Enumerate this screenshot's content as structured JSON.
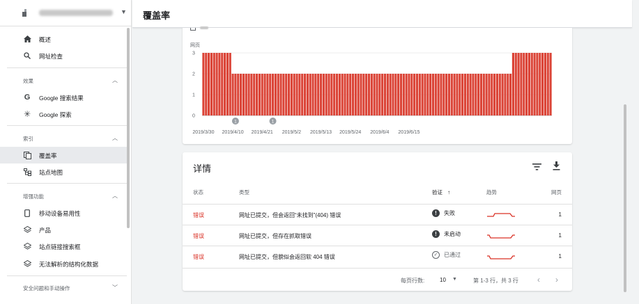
{
  "header": {
    "title": "覆盖率"
  },
  "sidebar": {
    "top_items": [
      {
        "icon": "home-icon",
        "label": "概述"
      },
      {
        "icon": "search-icon",
        "label": "网址检查"
      }
    ],
    "sections": [
      {
        "title": "效果",
        "items": [
          {
            "icon": "google-g-icon",
            "label": "Google 搜索结果"
          },
          {
            "icon": "asterisk-icon",
            "label": "Google 探索"
          }
        ]
      },
      {
        "title": "索引",
        "items": [
          {
            "icon": "coverage-icon",
            "label": "覆盖率",
            "active": true
          },
          {
            "icon": "sitemap-icon",
            "label": "站点地图"
          }
        ]
      },
      {
        "title": "增强功能",
        "items": [
          {
            "icon": "mobile-icon",
            "label": "移动设备易用性"
          },
          {
            "icon": "layers-icon",
            "label": "产品"
          },
          {
            "icon": "layers-icon",
            "label": "站点链接搜索框"
          },
          {
            "icon": "layers-icon",
            "label": "无法解析的结构化数据"
          }
        ]
      },
      {
        "title": "安全问题和手动操作",
        "items": []
      }
    ]
  },
  "chart": {
    "ylabel": "网页",
    "y_ticks": [
      "3",
      "2",
      "1",
      "0"
    ],
    "x_labels": [
      "2019/3/30",
      "2019/4/10",
      "2019/4/21",
      "2019/5/2",
      "2019/5/13",
      "2019/5/24",
      "2019/6/4",
      "2019/6/15"
    ],
    "annotation": "1",
    "bar_color": "#db4437"
  },
  "chart_data": {
    "type": "bar",
    "ylabel": "网页",
    "ylim": [
      0,
      3
    ],
    "x_tick_labels": [
      "2019/3/30",
      "2019/4/10",
      "2019/4/21",
      "2019/5/2",
      "2019/5/13",
      "2019/5/24",
      "2019/6/4",
      "2019/6/15"
    ],
    "series": [
      {
        "values": [
          3,
          3,
          3,
          3,
          3,
          3,
          3,
          3,
          3,
          3,
          3,
          2,
          2,
          2,
          2,
          2,
          2,
          2,
          2,
          2,
          2,
          2,
          2,
          2,
          2,
          2,
          2,
          2,
          2,
          2,
          2,
          2,
          2,
          2,
          2,
          2,
          2,
          2,
          2,
          2,
          2,
          2,
          2,
          2,
          2,
          2,
          2,
          2,
          2,
          2,
          2,
          2,
          2,
          2,
          2,
          2,
          2,
          2,
          2,
          2,
          2,
          2,
          2,
          2,
          2,
          2,
          2,
          2,
          2,
          2,
          2,
          2,
          2,
          2,
          2,
          2,
          2,
          2,
          2,
          2,
          2,
          2,
          2,
          2,
          2,
          2,
          2,
          2,
          2,
          2,
          2,
          2,
          2,
          2,
          2,
          2,
          2,
          2,
          2,
          2,
          2,
          2,
          2,
          2,
          2,
          2,
          2,
          2,
          2,
          2,
          2,
          2,
          2,
          2,
          2,
          2,
          3,
          3,
          3,
          3,
          3,
          3,
          3,
          3,
          3,
          3,
          3,
          3,
          3,
          3,
          3
        ]
      }
    ],
    "annotations": [
      {
        "x": "2019/4/11",
        "label": "1"
      },
      {
        "x": "2019/4/25",
        "label": "1"
      }
    ],
    "grid": true
  },
  "details": {
    "title": "详情",
    "columns": {
      "status": "状态",
      "type": "类型",
      "verify": "验证",
      "sort_arrow": "↑",
      "trend": "趋势",
      "pages": "网页"
    },
    "rows": [
      {
        "status": "错误",
        "type": "网址已提交，但会返回“未找到”(404) 错误",
        "verify_icon": "exclamation-icon",
        "verify": "失败",
        "pages": "1"
      },
      {
        "status": "错误",
        "type": "网址已提交，但存在抓取错误",
        "verify_icon": "exclamation-icon",
        "verify": "未启动",
        "pages": "1"
      },
      {
        "status": "错误",
        "type": "网址已提交，但貌似会返回软 404 错误",
        "verify_icon": "check-circle-icon",
        "verify": "已通过",
        "pages": "1"
      }
    ],
    "footer": {
      "rows_per_page_label": "每页行数:",
      "rows_per_page": "10",
      "range": "第 1-3 行，共 3 行"
    }
  }
}
